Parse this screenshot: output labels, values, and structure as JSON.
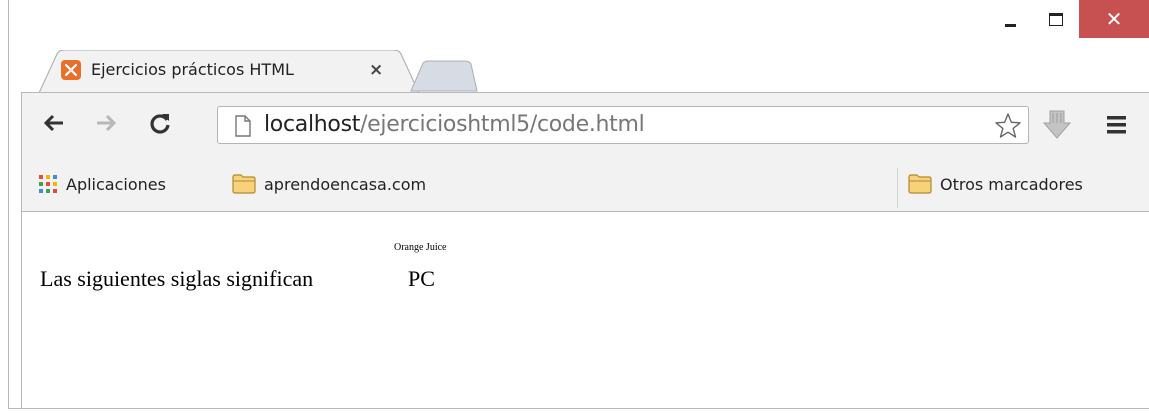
{
  "window": {
    "controls": {
      "minimize_icon": "minimize-icon",
      "maximize_icon": "maximize-icon",
      "close_icon": "close-icon",
      "close_glyph": "✕",
      "close_color": "#c75050"
    }
  },
  "tab": {
    "title": "Ejercicios prácticos HTML",
    "close_glyph": "×",
    "favicon_color": "#e8702a"
  },
  "toolbar": {
    "url_host": "localhost",
    "url_path": "/ejercicioshtml5/code.html"
  },
  "bookmarks": {
    "items": [
      {
        "label": "Aplicaciones",
        "icon": "apps-grid-icon"
      },
      {
        "label": "aprendoencasa.com",
        "icon": "folder-icon"
      }
    ],
    "other_label": "Otros marcadores"
  },
  "page": {
    "text": "Las siguientes siglas significan",
    "ruby_base": "PC",
    "ruby_annotation": "Orange Juice"
  }
}
